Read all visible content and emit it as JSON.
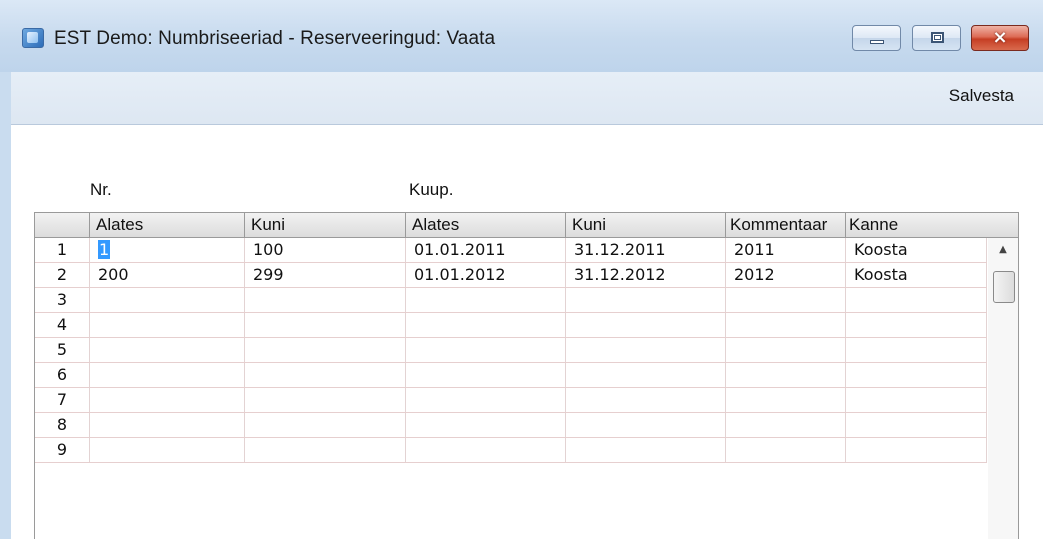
{
  "window": {
    "title": "EST Demo: Numbriseeriad - Reserveeringud: Vaata",
    "controls": {
      "minimize": "minimize-icon",
      "maximize": "maximize-icon",
      "close": "×"
    }
  },
  "toolbar": {
    "save_label": "Salvesta"
  },
  "groups": {
    "nr_label": "Nr.",
    "date_label": "Kuup."
  },
  "table": {
    "columns": [
      "",
      "Alates",
      "Kuni",
      "Alates",
      "Kuni",
      "Kommentaar",
      "Kanne"
    ],
    "rows": [
      {
        "num": "1",
        "from": "1",
        "to": "100",
        "date_from": "01.01.2011",
        "date_to": "31.12.2011",
        "comment": "2011",
        "entry": "Koosta"
      },
      {
        "num": "2",
        "from": "200",
        "to": "299",
        "date_from": "01.01.2012",
        "date_to": "31.12.2012",
        "comment": "2012",
        "entry": "Koosta"
      },
      {
        "num": "3",
        "from": "",
        "to": "",
        "date_from": "",
        "date_to": "",
        "comment": "",
        "entry": ""
      },
      {
        "num": "4",
        "from": "",
        "to": "",
        "date_from": "",
        "date_to": "",
        "comment": "",
        "entry": ""
      },
      {
        "num": "5",
        "from": "",
        "to": "",
        "date_from": "",
        "date_to": "",
        "comment": "",
        "entry": ""
      },
      {
        "num": "6",
        "from": "",
        "to": "",
        "date_from": "",
        "date_to": "",
        "comment": "",
        "entry": ""
      },
      {
        "num": "7",
        "from": "",
        "to": "",
        "date_from": "",
        "date_to": "",
        "comment": "",
        "entry": ""
      },
      {
        "num": "8",
        "from": "",
        "to": "",
        "date_from": "",
        "date_to": "",
        "comment": "",
        "entry": ""
      },
      {
        "num": "9",
        "from": "",
        "to": "",
        "date_from": "",
        "date_to": "",
        "comment": "",
        "entry": ""
      }
    ]
  },
  "colors": {
    "selection": "#3399ff",
    "titlebar": "#c7daee",
    "close_button": "#c63e24"
  }
}
